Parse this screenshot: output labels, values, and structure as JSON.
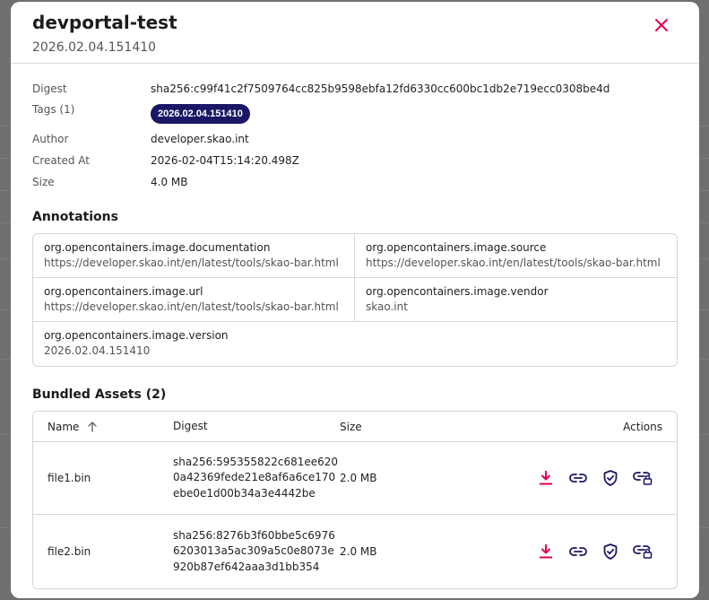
{
  "dialog": {
    "title": "devportal-test",
    "subtitle": "2026.02.04.151410"
  },
  "meta": {
    "digest_label": "Digest",
    "digest_value": "sha256:c99f41c2f7509764cc825b9598ebfa12fd6330cc600bc1db2e719ecc0308be4d",
    "tags_label": "Tags (1)",
    "tags": [
      "2026.02.04.151410"
    ],
    "author_label": "Author",
    "author_value": "developer.skao.int",
    "created_label": "Created At",
    "created_value": "2026-02-04T15:14:20.498Z",
    "size_label": "Size",
    "size_value": "4.0 MB"
  },
  "annotations": {
    "title": "Annotations",
    "items": [
      {
        "key": "org.opencontainers.image.documentation",
        "value": "https://developer.skao.int/en/latest/tools/skao-bar.html"
      },
      {
        "key": "org.opencontainers.image.source",
        "value": "https://developer.skao.int/en/latest/tools/skao-bar.html"
      },
      {
        "key": "org.opencontainers.image.url",
        "value": "https://developer.skao.int/en/latest/tools/skao-bar.html"
      },
      {
        "key": "org.opencontainers.image.vendor",
        "value": "skao.int"
      },
      {
        "key": "org.opencontainers.image.version",
        "value": "2026.02.04.151410"
      }
    ]
  },
  "assets": {
    "title": "Bundled Assets (2)",
    "columns": {
      "name": "Name",
      "digest": "Digest",
      "size": "Size",
      "actions": "Actions"
    },
    "rows": [
      {
        "name": "file1.bin",
        "digest": "sha256:595355822c681ee6200a42369fede21e8af6a6ce170ebe0e1d00b34a3e4442be",
        "size": "2.0 MB"
      },
      {
        "name": "file2.bin",
        "digest": "sha256:8276b3f60bbe5c69766203013a5ac309a5c0e8073e920b87ef642aaa3d1bb354",
        "size": "2.0 MB"
      }
    ]
  },
  "colors": {
    "accent": "#e0005a",
    "navy": "#1a1766"
  }
}
